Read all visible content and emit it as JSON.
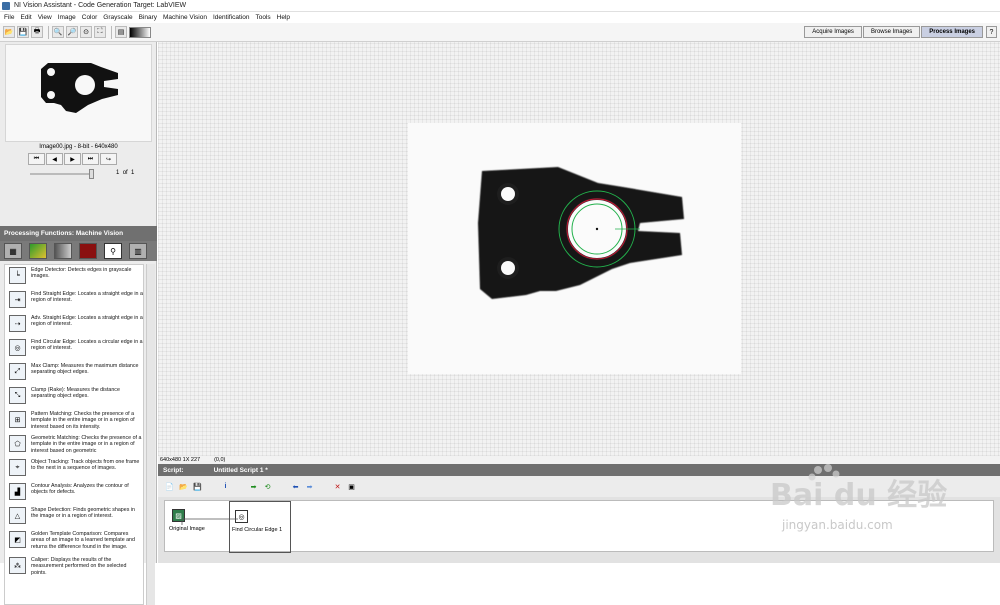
{
  "window": {
    "title": "NI Vision Assistant - Code Generation Target: LabVIEW"
  },
  "menu": [
    "File",
    "Edit",
    "View",
    "Image",
    "Color",
    "Grayscale",
    "Binary",
    "Machine Vision",
    "Identification",
    "Tools",
    "Help"
  ],
  "mode_tabs": [
    "Acquire Images",
    "Browse Images",
    "Process Images"
  ],
  "active_tab": "Process Images",
  "help_icon": "?",
  "thumbnail": {
    "info": "Image00.jpg - 8-bit - 640x480",
    "page": "1",
    "of_label": "of",
    "total": "1"
  },
  "nav_buttons": [
    "⏮",
    "◀",
    "▶",
    "⏭",
    "↪"
  ],
  "processing": {
    "header": "Processing Functions: Machine Vision",
    "categories": [
      "image-icon",
      "color-icon",
      "grayscale-icon",
      "binary-icon",
      "machine-vision-icon",
      "identification-icon"
    ],
    "functions": [
      {
        "name": "Edge Detector",
        "desc": "Edge Detector:  Detects edges in grayscale images.",
        "icon": "edge-detector-icon"
      },
      {
        "name": "Find Straight Edge",
        "desc": "Find Straight Edge:  Locates a straight edge in a region of interest.",
        "icon": "find-straight-edge-icon"
      },
      {
        "name": "Adv. Straight Edge",
        "desc": "Adv. Straight Edge:  Locates a straight edge in a region of interest.",
        "icon": "adv-straight-edge-icon"
      },
      {
        "name": "Find Circular Edge",
        "desc": "Find Circular Edge:  Locates a circular edge in a region of interest.",
        "icon": "find-circular-edge-icon"
      },
      {
        "name": "Max Clamp",
        "desc": "Max Clamp:  Measures the maximum distance separating object edges.",
        "icon": "max-clamp-icon"
      },
      {
        "name": "Clamp (Rake)",
        "desc": "Clamp (Rake):  Measures the distance separating object edges.",
        "icon": "clamp-rake-icon"
      },
      {
        "name": "Pattern Matching",
        "desc": "Pattern Matching:  Checks the presence of a template in the entire image or in a region of interest based on its intensity.",
        "icon": "pattern-matching-icon"
      },
      {
        "name": "Geometric Matching",
        "desc": "Geometric Matching:  Checks the presence of a template in the entire image or in a region of interest based on geometric",
        "icon": "geometric-matching-icon"
      },
      {
        "name": "Object Tracking",
        "desc": "Object Tracking:  Track objects from one frame to the next in a sequence of images.",
        "icon": "object-tracking-icon"
      },
      {
        "name": "Contour Analysis",
        "desc": "Contour Analysis:  Analyzes the contour of objects for defects.",
        "icon": "contour-analysis-icon"
      },
      {
        "name": "Shape Detection",
        "desc": "Shape Detection:  Finds geometric shapes in the image or in a region of interest.",
        "icon": "shape-detection-icon"
      },
      {
        "name": "Golden Template Comparison",
        "desc": "Golden Template Comparison:  Compares areas of an image to a learned template and returns the difference found in the image.",
        "icon": "golden-template-icon"
      },
      {
        "name": "Caliper",
        "desc": "Caliper:  Displays the results of the measurement performed on the selected points.",
        "icon": "caliper-icon"
      }
    ]
  },
  "status": {
    "size": "640x480 1X 227",
    "coords": "(0,0)"
  },
  "script": {
    "header": "Script:",
    "name": "Untitled Script 1 *",
    "steps": [
      {
        "label": "Original Image",
        "icon": "original-image-icon"
      },
      {
        "label": "Find Circular Edge 1",
        "icon": "find-circular-edge-icon"
      }
    ]
  },
  "watermark": {
    "brand": "Bai du 经验",
    "url": "jingyan.baidu.com"
  },
  "colors": {
    "panel_header": "#707070",
    "active_tab": "#c9cfe2",
    "circle_edge": "#22b14c",
    "circle_fit": "#d01030"
  }
}
